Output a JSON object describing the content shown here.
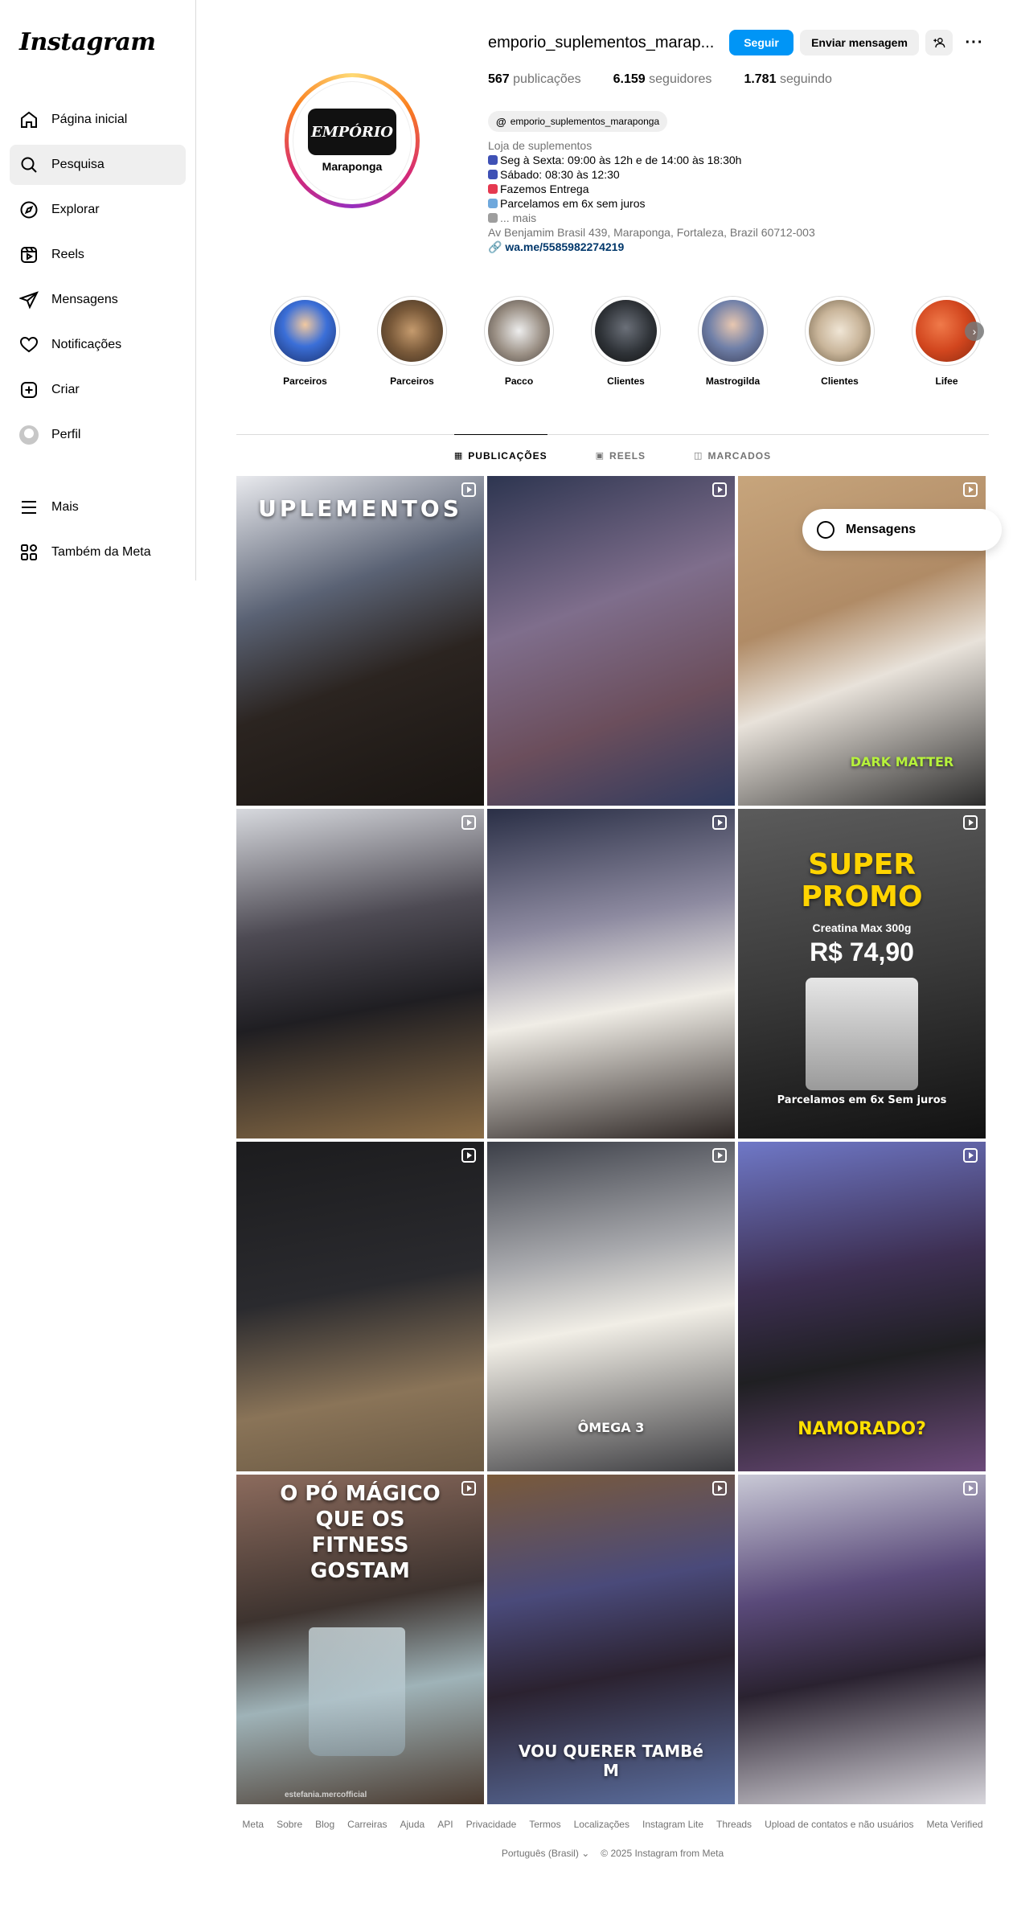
{
  "brand": {
    "logo_text": "Instagram"
  },
  "nav": [
    {
      "id": "home",
      "label": "Página inicial",
      "icon": "home-icon"
    },
    {
      "id": "search",
      "label": "Pesquisa",
      "icon": "search-icon",
      "active": true
    },
    {
      "id": "explore",
      "label": "Explorar",
      "icon": "compass-icon"
    },
    {
      "id": "reels",
      "label": "Reels",
      "icon": "reels-icon"
    },
    {
      "id": "messages",
      "label": "Mensagens",
      "icon": "send-icon"
    },
    {
      "id": "notifications",
      "label": "Notificações",
      "icon": "heart-icon"
    },
    {
      "id": "create",
      "label": "Criar",
      "icon": "plus-square-icon"
    },
    {
      "id": "profile",
      "label": "Perfil",
      "icon": "avatar"
    }
  ],
  "nav_bottom": [
    {
      "id": "more",
      "label": "Mais",
      "icon": "hamburger-icon"
    },
    {
      "id": "meta",
      "label": "Também da Meta",
      "icon": "meta-apps-icon"
    }
  ],
  "profile": {
    "username": "emporio_suplementos_marap...",
    "follow_label": "Seguir",
    "message_label": "Enviar mensagem",
    "avatar_logo_text": "EMPÓRIO",
    "avatar_city": "Maraponga",
    "posts_count": "567",
    "posts_label": "publicações",
    "followers_count": "6.159",
    "followers_label": "seguidores",
    "following_count": "1.781",
    "following_label": "seguindo",
    "threads_handle": "emporio_suplementos_maraponga",
    "category": "Loja de suplementos",
    "bio_lines": [
      "Seg à Sexta: 09:00 às 12h e de 14:00 às 18:30h",
      "Sábado: 08:30 às 12:30",
      "Fazemos Entrega",
      "Parcelamos em 6x sem juros"
    ],
    "more_label": "... mais",
    "address": "Av Benjamim Brasil 439, Maraponga, Fortaleza, Brazil 60712-003",
    "link": "wa.me/5585982274219"
  },
  "highlights": [
    {
      "label": "Parceiros",
      "color": "#3b6fd8"
    },
    {
      "label": "Parceiros",
      "color": "#7a5a3a"
    },
    {
      "label": "Pacco",
      "color": "#9a8f84"
    },
    {
      "label": "Clientes",
      "color": "#2f3338"
    },
    {
      "label": "Mastrogilda",
      "color": "#6f7fa8"
    },
    {
      "label": "Clientes",
      "color": "#c9b59a"
    },
    {
      "label": "Lifee",
      "color": "#d2461e"
    }
  ],
  "tabs": [
    {
      "label": "PUBLICAÇÕES",
      "active": true
    },
    {
      "label": "REELS",
      "active": false
    },
    {
      "label": "MARCADOS",
      "active": false
    }
  ],
  "posts": [
    {
      "bg": "linear-gradient(160deg,#e9eaee 0%,#5a6274 35%,#2b2420 60%,#191512 100%)",
      "caption": "",
      "top_text": "UPLEMENTOS"
    },
    {
      "bg": "linear-gradient(160deg,#2d3550 0%,#7f6e8c 40%,#6b4e5c 70%,#2f3a5e 100%)",
      "caption": "",
      "top_text": ""
    },
    {
      "bg": "linear-gradient(160deg,#c7a57c 0%,#b08b66 40%,#e8e2da 60%,#2c2c2c 100%)",
      "caption": "DARK MATTER",
      "top_text": ""
    },
    {
      "bg": "linear-gradient(170deg,#d7d9de 0%,#4d4a53 35%,#1f1e22 60%,#8b6d46 100%)",
      "caption": "",
      "top_text": ""
    },
    {
      "bg": "linear-gradient(170deg,#2a2f46 0%,#8d8aa0 35%,#f0ede6 60%,#2d2624 100%)",
      "caption": "",
      "top_text": ""
    },
    {
      "bg": "linear-gradient(170deg,#5b5b5b 0%,#3a3a3a 50%,#121212 100%)",
      "caption": "Parcelamos em 6x Sem juros",
      "top_text": "SUPER PROMO",
      "promo_sub": "Creatina Max 300g",
      "promo_price": "R$ 74,90"
    },
    {
      "bg": "linear-gradient(170deg,#1c1c1e 0%,#2a2a2e 45%,#8a7458 75%,#6b5a44 100%)",
      "caption": "",
      "top_text": ""
    },
    {
      "bg": "linear-gradient(170deg,#3c3f48 0%,#a8a9ad 35%,#f1eee6 55%,#3c3c40 100%)",
      "caption": "ÔMEGA 3",
      "top_text": ""
    },
    {
      "bg": "linear-gradient(170deg,#6f78c7 0%,#3d2f52 40%,#1f1f22 65%,#6c4a7a 100%)",
      "caption": "NAMORADO?",
      "top_text": ""
    },
    {
      "bg": "linear-gradient(170deg,#8c6b5d 0%,#3d332f 40%,#9fb3b8 65%,#4a3a2f 100%)",
      "caption": "",
      "top_text": "O PÓ MÁGICO QUE OS FITNESS GOSTAM",
      "bottom_tag": "estefania.mercofficial"
    },
    {
      "bg": "linear-gradient(170deg,#7a5a3a 0%,#4a4a7a 35%,#2b2230 60%,#5b6fa0 100%)",
      "caption": "VOU QUERER TAMBé M",
      "top_text": ""
    },
    {
      "bg": "linear-gradient(170deg,#c9c9d6 0%,#5a4a7a 35%,#2a2230 60%,#d8d6dc 100%)",
      "caption": "",
      "top_text": ""
    }
  ],
  "floating": {
    "messages_label": "Mensagens"
  },
  "footer": {
    "links": [
      "Meta",
      "Sobre",
      "Blog",
      "Carreiras",
      "Ajuda",
      "API",
      "Privacidade",
      "Termos",
      "Localizações",
      "Instagram Lite",
      "Threads",
      "Upload de contatos e não usuários",
      "Meta Verified"
    ],
    "language": "Português (Brasil)",
    "copyright": "© 2025 Instagram from Meta"
  },
  "colors": {
    "accent": "#0095f6",
    "link": "#00376b",
    "muted": "#737373"
  }
}
